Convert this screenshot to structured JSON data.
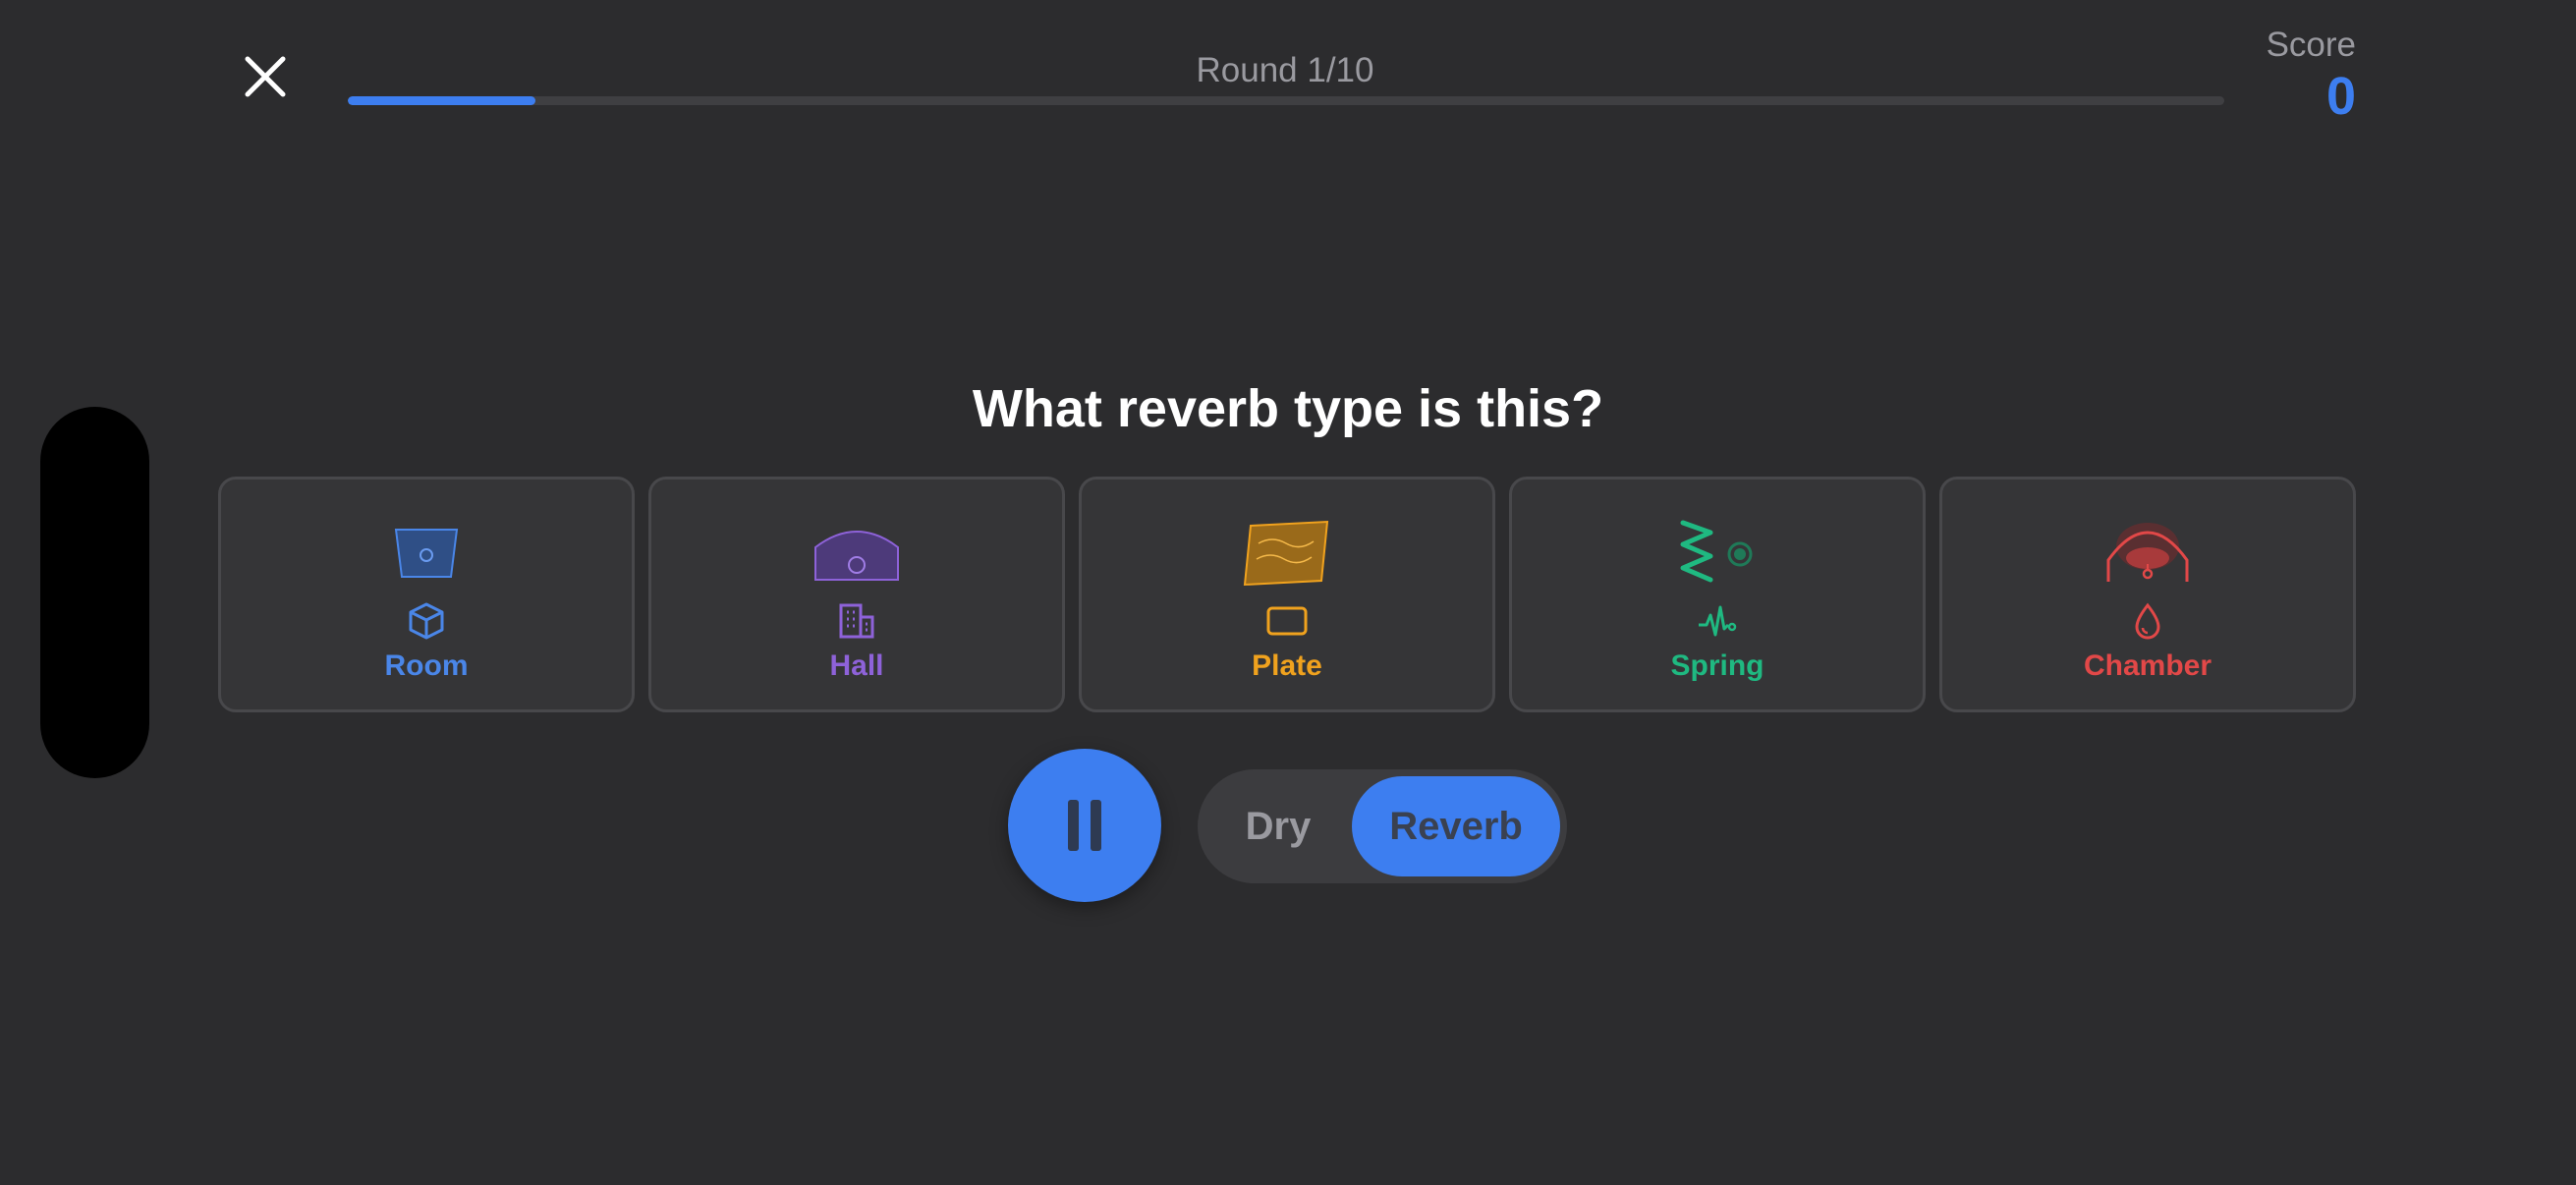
{
  "header": {
    "close_icon": "close-icon",
    "round_label": "Round 1/10",
    "round_current": 1,
    "round_total": 10,
    "score_label": "Score",
    "score_value": "0"
  },
  "question": "What reverb type is this?",
  "options": [
    {
      "label": "Room",
      "color": "#4a86e8",
      "icon": "cube-icon",
      "illustration": "room-illustration"
    },
    {
      "label": "Hall",
      "color": "#8e62d9",
      "icon": "building-icon",
      "illustration": "hall-illustration"
    },
    {
      "label": "Plate",
      "color": "#f0a21e",
      "icon": "rectangle-icon",
      "illustration": "plate-illustration"
    },
    {
      "label": "Spring",
      "color": "#1fb981",
      "icon": "waveform-icon",
      "illustration": "spring-illustration"
    },
    {
      "label": "Chamber",
      "color": "#e24848",
      "icon": "drop-icon",
      "illustration": "chamber-illustration"
    }
  ],
  "playback": {
    "play_icon": "pause-icon",
    "toggle_dry": "Dry",
    "toggle_reverb": "Reverb",
    "selected": "Reverb"
  },
  "colors": {
    "accent": "#3d7ef0",
    "background": "#2c2c2e"
  }
}
